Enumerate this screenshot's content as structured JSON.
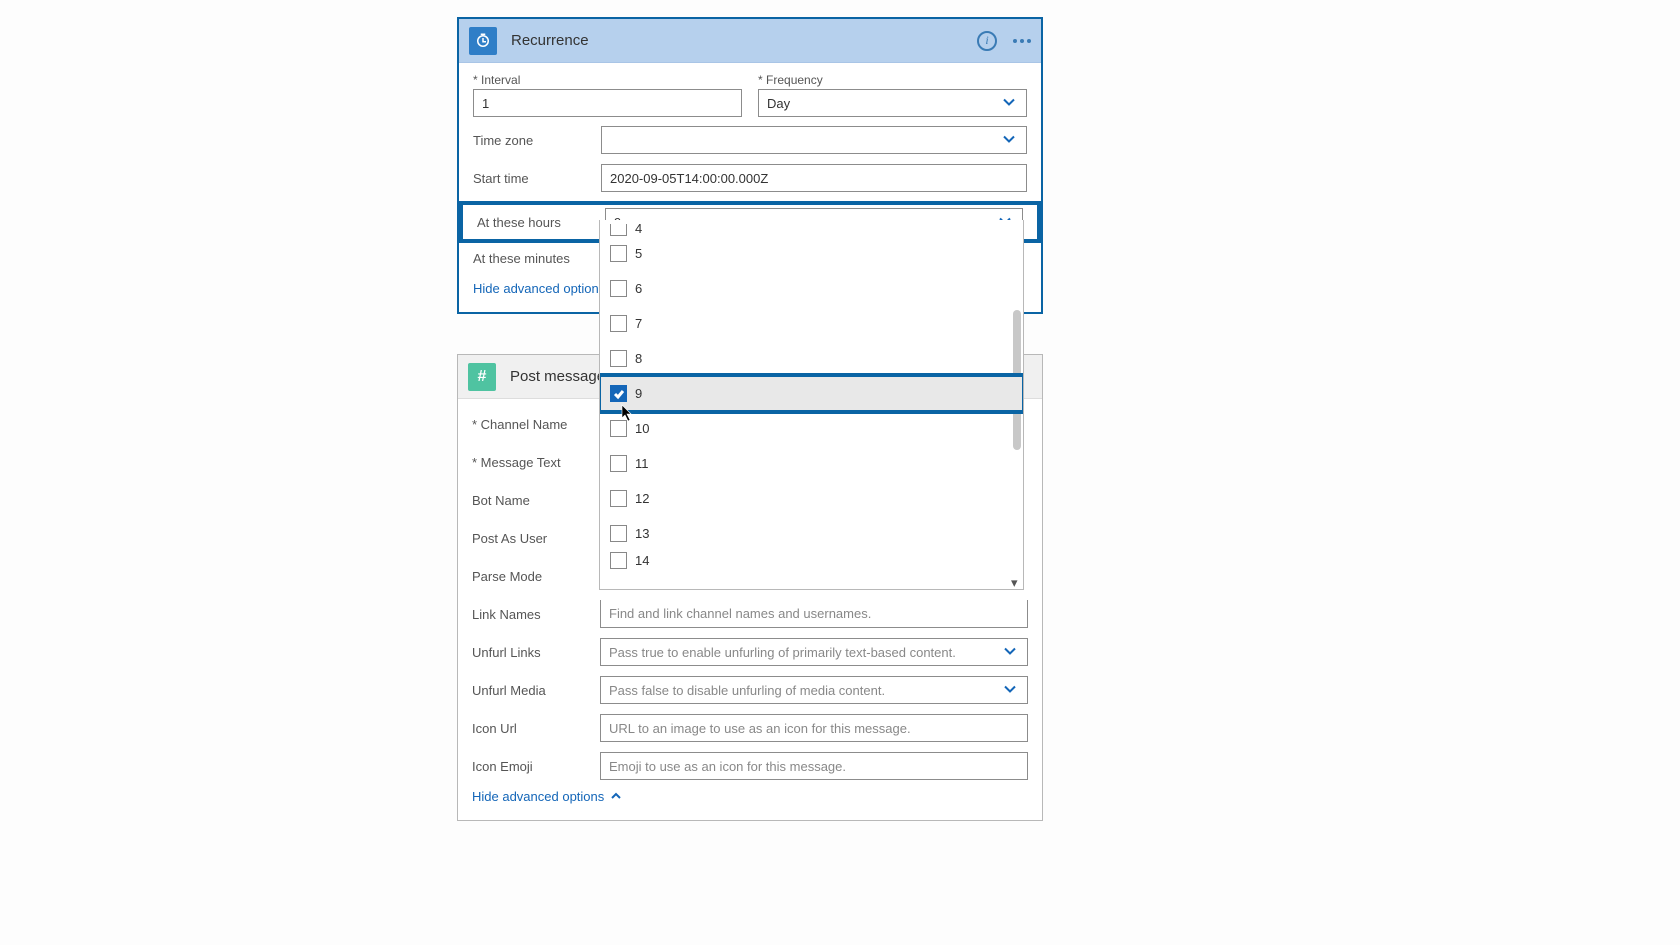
{
  "recurrence": {
    "title": "Recurrence",
    "interval_label": "Interval",
    "interval_value": "1",
    "frequency_label": "Frequency",
    "frequency_value": "Day",
    "timezone_label": "Time zone",
    "timezone_value": "",
    "start_time_label": "Start time",
    "start_time_value": "2020-09-05T14:00:00.000Z",
    "hours_label": "At these hours",
    "hours_value": "9",
    "minutes_label": "At these minutes",
    "hide_link": "Hide advanced options"
  },
  "hours_dropdown": {
    "options": [
      {
        "label": "4",
        "checked": false,
        "partial_top": true
      },
      {
        "label": "5",
        "checked": false
      },
      {
        "label": "6",
        "checked": false
      },
      {
        "label": "7",
        "checked": false
      },
      {
        "label": "8",
        "checked": false
      },
      {
        "label": "9",
        "checked": true,
        "selected": true,
        "highlighted": true
      },
      {
        "label": "10",
        "checked": false
      },
      {
        "label": "11",
        "checked": false
      },
      {
        "label": "12",
        "checked": false
      },
      {
        "label": "13",
        "checked": false
      },
      {
        "label": "14",
        "checked": false,
        "partial_bottom": true
      }
    ]
  },
  "post": {
    "title": "Post message",
    "channel_name_label": "Channel Name",
    "message_text_label": "Message Text",
    "bot_name_label": "Bot Name",
    "post_as_user_label": "Post As User",
    "parse_mode_label": "Parse Mode",
    "link_names_label": "Link Names",
    "link_names_placeholder": "Find and link channel names and usernames.",
    "unfurl_links_label": "Unfurl Links",
    "unfurl_links_placeholder": "Pass true to enable unfurling of primarily text-based content.",
    "unfurl_media_label": "Unfurl Media",
    "unfurl_media_placeholder": "Pass false to disable unfurling of media content.",
    "icon_url_label": "Icon Url",
    "icon_url_placeholder": "URL to an image to use as an icon for this message.",
    "icon_emoji_label": "Icon Emoji",
    "icon_emoji_placeholder": "Emoji to use as an icon for this message.",
    "hide_link": "Hide advanced options"
  }
}
